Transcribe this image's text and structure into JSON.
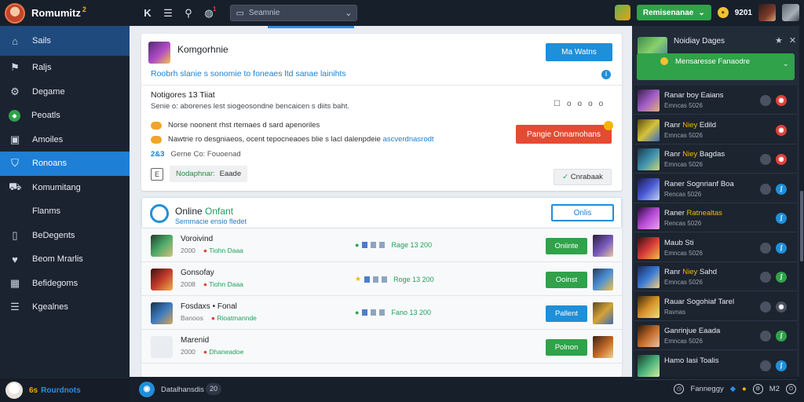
{
  "app": {
    "name": "Romumitz",
    "badge": "2"
  },
  "topbar": {
    "icons": [
      "logo-icon",
      "menu-icon",
      "search-icon",
      "alert-icon"
    ],
    "alert_badge": "1",
    "search_placeholder": "Seamnie",
    "status_button": "Remisenanae",
    "coins": "9201"
  },
  "sidebar": {
    "items": [
      {
        "icon": "home-icon",
        "label": "Sails"
      },
      {
        "icon": "chart-icon",
        "label": "Raljs"
      },
      {
        "icon": "settings-icon",
        "label": "Degame"
      },
      {
        "icon": "green-badge-icon",
        "label": "Peoatls"
      },
      {
        "icon": "monitor-icon",
        "label": "Amoiles"
      },
      {
        "icon": "shield-icon",
        "label": "Ronoans"
      },
      {
        "icon": "car-icon",
        "label": "Komumitang"
      },
      {
        "icon": "",
        "label": "Flanms"
      },
      {
        "icon": "phone-icon",
        "label": "BeDegents"
      },
      {
        "icon": "heart-icon",
        "label": "Beom Mrarlis"
      },
      {
        "icon": "grid-icon",
        "label": "Befidegoms"
      },
      {
        "icon": "bars-icon",
        "label": "Kgealnes"
      }
    ],
    "footer_badge": "6s",
    "footer_label": "Rourdnots"
  },
  "main": {
    "card1": {
      "title": "Komgorhnie",
      "button": "Ma Watns",
      "link": "Roobrh slanie s sonomie to foneaes ltd sanae lainihts",
      "sub_title": "Notigores 13 Tiiat",
      "sub_desc": "Senie o: aborenes lest siogeosondne bencaicen s diits baht.",
      "mini_ctrls": [
        "☐",
        "o",
        "o",
        "o",
        "o"
      ],
      "bullets": [
        {
          "text": "Norse noonent rhst rtemaes d sard apenoriles",
          "hl": ""
        },
        {
          "text": "Nawtrie ro desgniaeos, ocent tepocneaoes blie s lacl dalenpdeie ",
          "hl": "ascverdnasrodt"
        }
      ],
      "orange_button": "Pangie Onnamohans",
      "meta_num": "2&3",
      "meta_text": "Gerne Co: Fouoenad",
      "tag_icon": "E",
      "tag_green": "Nodaphnar:",
      "tag_plain": "Eaade",
      "check_button": "Cnrabaak"
    },
    "card2": {
      "title": "Online",
      "title_accent": "Onfant",
      "subtitle": "Semmacie ensio fledet",
      "online_button": "Onlis",
      "rows": [
        {
          "name": "Voroivind",
          "m1": "2000",
          "m2": "Tiohn Daaa",
          "stat_icon": "●",
          "stat_text": "Rage 13 200",
          "button": "Oniinte",
          "btn": "green"
        },
        {
          "name": "Gonsofay",
          "m1": "2008",
          "m2": "Tiohn Daaa",
          "stat_icon": "★",
          "stat_text": "Roge 13 200",
          "button": "Ooinst",
          "btn": "green"
        },
        {
          "name": "Fosdaxs • Fonal",
          "m1": "Banoos",
          "m2": "Rioatmannde",
          "stat_icon": "●",
          "stat_text": "Fano 13 200",
          "button": "Pallent",
          "btn": "blue"
        },
        {
          "name": "Marenid",
          "m1": "2000",
          "m2": "Dhaneadoe",
          "stat_icon": "",
          "stat_text": "",
          "button": "Polnon",
          "btn": "green"
        }
      ]
    }
  },
  "bottombar": {
    "label": "Datalhansdis",
    "pill": "20",
    "right_label": "Fanneggy",
    "right_suffix": "M2"
  },
  "rpanel": {
    "head_title": "Noidiay Dages",
    "head_green": "Mensaresse Fanaodre",
    "rows": [
      {
        "name": "Ranar boy ",
        "name_hl": "",
        "name2": "Eaians",
        "sub": "Emncas 5026",
        "act": "red",
        "act2": true
      },
      {
        "name": "Ranr ",
        "name_hl": "Niey",
        "name2": " Edild",
        "sub": "Emncas 5026",
        "act": "red",
        "act2": false
      },
      {
        "name": "Ranr ",
        "name_hl": "Niey",
        "name2": " Bagdas",
        "sub": "Emncas 5026",
        "act": "red",
        "act2": true
      },
      {
        "name": "Raner Sognrianf Boa",
        "name_hl": "",
        "name2": "",
        "sub": "Rencas 5026",
        "act": "blue",
        "act2": true
      },
      {
        "name": "Raner ",
        "name_hl": "Ratnealtas",
        "name2": "",
        "sub": "Rencas 5026",
        "act": "blue",
        "act2": false
      },
      {
        "name": "Maub Sti",
        "name_hl": "",
        "name2": "",
        "sub": "Emncas 5026",
        "act": "blue",
        "act2": true
      },
      {
        "name": "Ranr ",
        "name_hl": "Niey",
        "name2": " Sahd",
        "sub": "Emncas 5026",
        "act": "green",
        "act2": true
      },
      {
        "name": "Rauar Sogohiaf Tarel",
        "name_hl": "",
        "name2": "",
        "sub": "Ravnas",
        "act": "grey",
        "act2": true
      },
      {
        "name": "Ganrinjue Eaada",
        "name_hl": "",
        "name2": "",
        "sub": "Emncas 5026",
        "act": "green",
        "act2": true
      },
      {
        "name": "Hamo Iasi Toalis",
        "name_hl": "",
        "name2": "",
        "sub": "",
        "act": "blue",
        "act2": true
      }
    ]
  },
  "colors": {
    "accent": "#1e8fd9",
    "sidebar_active": "#1e7fd6",
    "success": "#2fa24a",
    "danger": "#e44b33",
    "topbar": "#171f2b"
  }
}
